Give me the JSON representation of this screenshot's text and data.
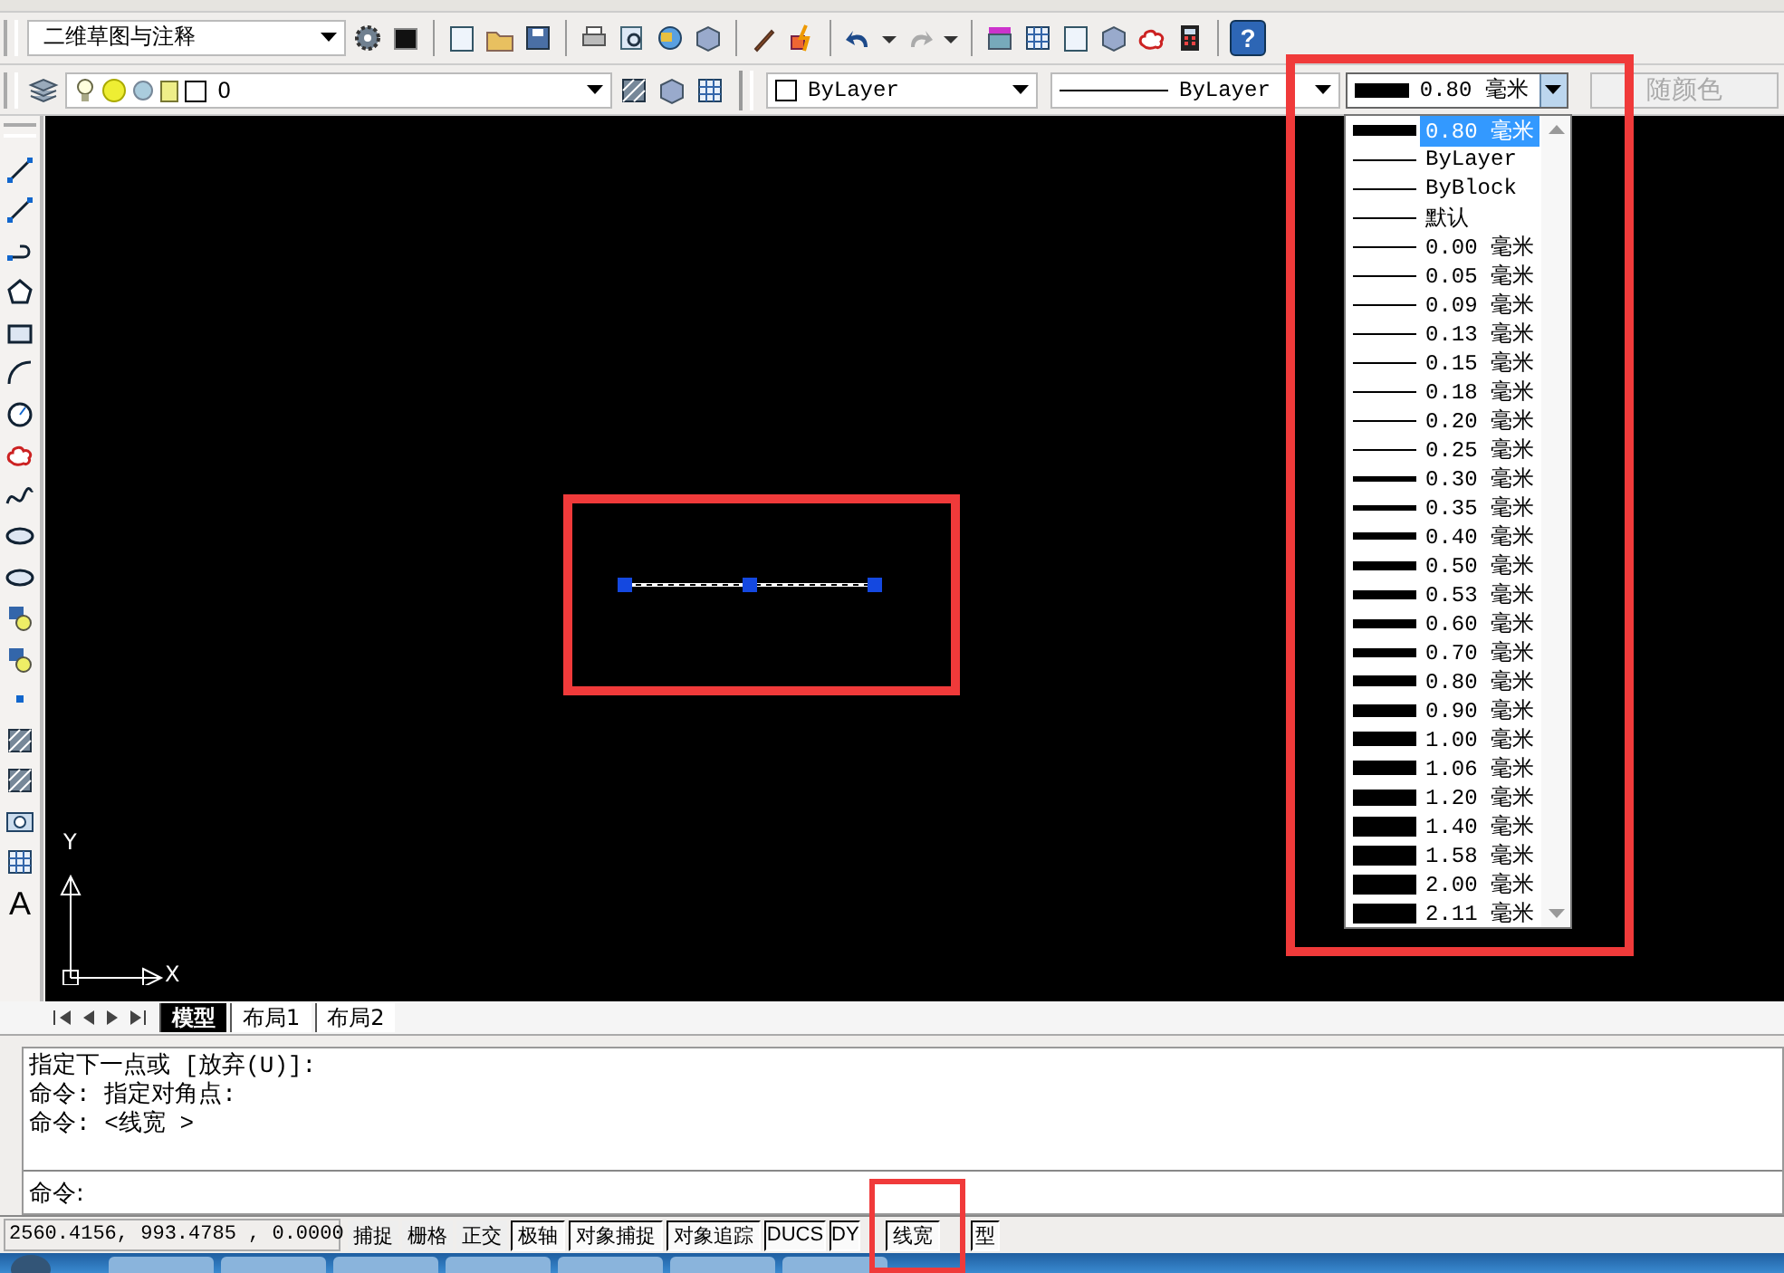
{
  "toolbar_top": {
    "workspace": "二维草图与注释",
    "help_button": "?"
  },
  "toolbar_properties": {
    "layer": "0",
    "color_setting": "ByLayer",
    "linetype": "ByLayer",
    "lineweight": "0.80 毫米",
    "plot_style": {
      "value": "随颜色",
      "disabled": true
    }
  },
  "lineweight_list": [
    {
      "label": "0.80 毫米",
      "kind": "heavy",
      "selected": true
    },
    {
      "label": "ByLayer",
      "kind": "thin",
      "selected": false
    },
    {
      "label": "ByBlock",
      "kind": "thin",
      "selected": false
    },
    {
      "label": "默认",
      "kind": "thin",
      "selected": false
    },
    {
      "label": "0.00 毫米",
      "kind": "thin",
      "selected": false
    },
    {
      "label": "0.05 毫米",
      "kind": "thin",
      "selected": false
    },
    {
      "label": "0.09 毫米",
      "kind": "thin",
      "selected": false
    },
    {
      "label": "0.13 毫米",
      "kind": "thin",
      "selected": false
    },
    {
      "label": "0.15 毫米",
      "kind": "thin",
      "selected": false
    },
    {
      "label": "0.18 毫米",
      "kind": "thin",
      "selected": false
    },
    {
      "label": "0.20 毫米",
      "kind": "thin",
      "selected": false
    },
    {
      "label": "0.25 毫米",
      "kind": "thin",
      "selected": false
    },
    {
      "label": "0.30 毫米",
      "kind": "light",
      "selected": false
    },
    {
      "label": "0.35 毫米",
      "kind": "light",
      "selected": false
    },
    {
      "label": "0.40 毫米",
      "kind": "regular",
      "selected": false
    },
    {
      "label": "0.50 毫米",
      "kind": "medium",
      "selected": false
    },
    {
      "label": "0.53 毫米",
      "kind": "medium",
      "selected": false
    },
    {
      "label": "0.60 毫米",
      "kind": "medium",
      "selected": false
    },
    {
      "label": "0.70 毫米",
      "kind": "medium",
      "selected": false
    },
    {
      "label": "0.80 毫米",
      "kind": "heavy",
      "selected": false
    },
    {
      "label": "0.90 毫米",
      "kind": "bold",
      "selected": false
    },
    {
      "label": "1.00 毫米",
      "kind": "black",
      "selected": false
    },
    {
      "label": "1.06 毫米",
      "kind": "black",
      "selected": false
    },
    {
      "label": "1.20 毫米",
      "kind": "ultra",
      "selected": false
    },
    {
      "label": "1.40 毫米",
      "kind": "max",
      "selected": false
    },
    {
      "label": "1.58 毫米",
      "kind": "max",
      "selected": false
    },
    {
      "label": "2.00 毫米",
      "kind": "max",
      "selected": false
    },
    {
      "label": "2.11 毫米",
      "kind": "max",
      "selected": false
    }
  ],
  "left_toolbar": {
    "text_tool": "A"
  },
  "canvas": {
    "ucs_y": "Y",
    "ucs_x": "X"
  },
  "layout_tabs": [
    {
      "label": "模型",
      "selected": true
    },
    {
      "label": "布局1",
      "selected": false
    },
    {
      "label": "布局2",
      "selected": false
    }
  ],
  "command_history": [
    "指定下一点或 [放弃(U)]:",
    "命令: 指定对角点:",
    "命令:  <线宽 >"
  ],
  "command_prompt": "命令:",
  "status_bar": {
    "coordinates": "2560.4156, 993.4785 , 0.0000",
    "buttons": [
      {
        "label": "捕捉",
        "on": false
      },
      {
        "label": "栅格",
        "on": false
      },
      {
        "label": "正交",
        "on": false
      },
      {
        "label": "极轴",
        "on": true
      },
      {
        "label": "对象捕捉",
        "on": true
      },
      {
        "label": "对象追踪",
        "on": true
      },
      {
        "label": "DUCS",
        "on": true
      },
      {
        "label": "DY",
        "on": true
      },
      {
        "label": "线宽",
        "on": true
      },
      {
        "label": "型",
        "on": true
      }
    ]
  }
}
